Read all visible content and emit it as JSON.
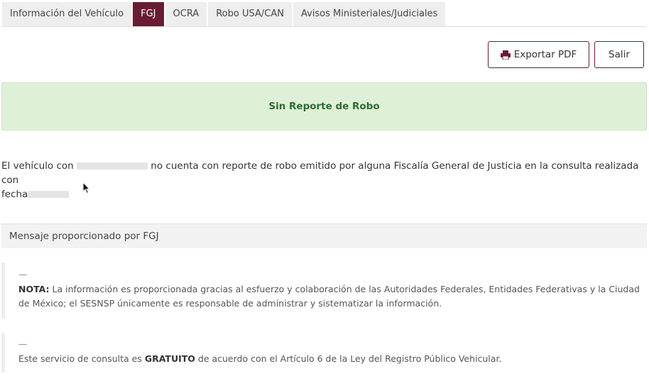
{
  "tabs": [
    {
      "label": "Información del Vehículo",
      "active": false
    },
    {
      "label": "FGJ",
      "active": true
    },
    {
      "label": "OCRA",
      "active": false
    },
    {
      "label": "Robo USA/CAN",
      "active": false
    },
    {
      "label": "Avisos Ministeriales/Judiciales",
      "active": false
    }
  ],
  "actions": {
    "export_label": "Exportar PDF",
    "export_icon": "printer-icon",
    "exit_label": "Salir"
  },
  "alert": {
    "text": "Sin Reporte de Robo",
    "background": "#dff0d8",
    "color": "#2f6b2f"
  },
  "description": {
    "prefix": "El vehículo con",
    "middle": "no cuenta con reporte de robo emitido por alguna Fiscalía General de Justicia en la consulta realizada con",
    "date_label": "fecha"
  },
  "message_header": "Mensaje proporcionado por FGJ",
  "notes": [
    {
      "dash": "—",
      "bold": "NOTA:",
      "text": " La información es proporcionada gracias al esfuerzo y colaboración de las Autoridades Federales, Entidades Federativas y la Ciudad de México; el SESNSP únicamente es responsable de administrar y sistematizar la información."
    },
    {
      "dash": "—",
      "before": "Este servicio de consulta es ",
      "bold": "GRATUITO",
      "after": " de acuerdo con el Artículo 6 de la Ley del Registro Público Vehicular."
    }
  ],
  "colors": {
    "accent": "#691c32",
    "tab_inactive": "#eeeeee"
  }
}
